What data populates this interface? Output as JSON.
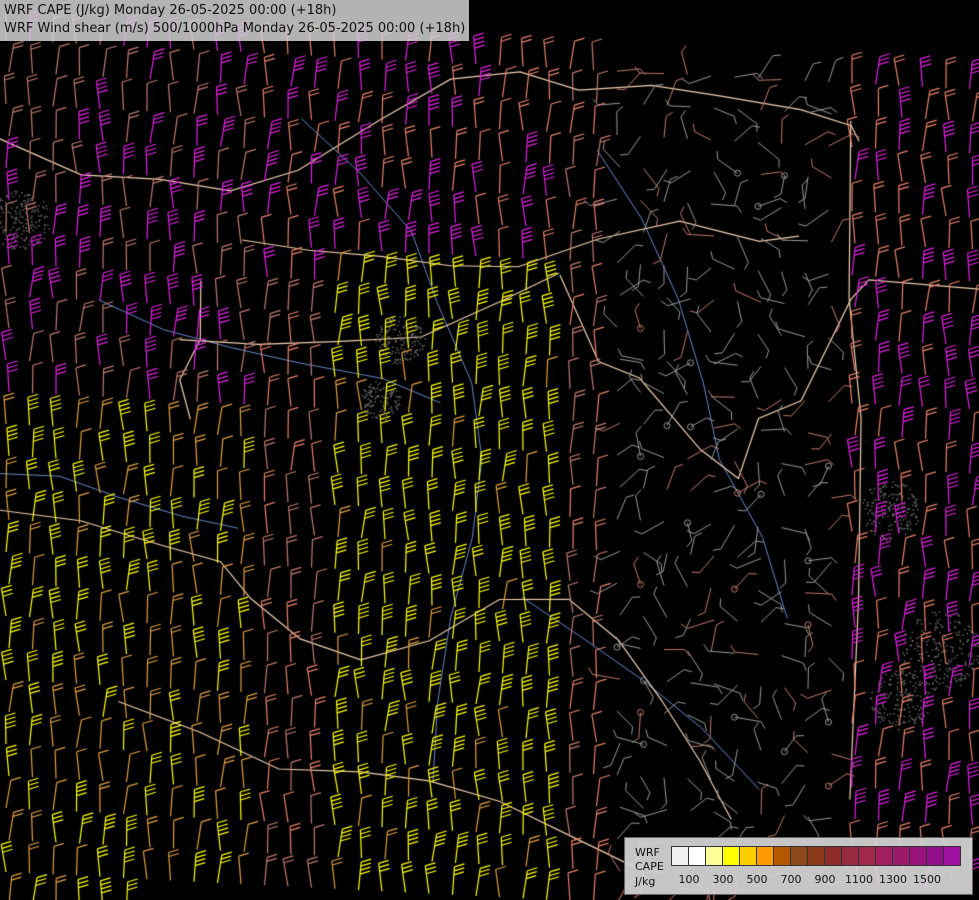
{
  "titles": {
    "line1": "WRF CAPE (J/kg) Monday 26-05-2025 00:00 (+18h)",
    "line2": "WRF Wind shear (m/s) 500/1000hPa Monday 26-05-2025 00:00 (+18h)"
  },
  "legend": {
    "label_wrf": "WRF",
    "label_cape": "CAPE",
    "label_unit": "J/kg",
    "colors": [
      "#f0f0f0",
      "#ffffff",
      "#ffff99",
      "#ffff00",
      "#ffcc00",
      "#ff9900",
      "#b35900",
      "#8c4a1a",
      "#8a3a1a",
      "#8e2a2a",
      "#962a40",
      "#a0284a",
      "#a02060",
      "#9c1a6a",
      "#98147a",
      "#92108a",
      "#a010a0"
    ],
    "tick_labels": [
      "100",
      "300",
      "500",
      "700",
      "900",
      "1100",
      "1300",
      "1500"
    ]
  },
  "barb_colors": {
    "grey": "#9a9a9a",
    "brown": "#c07a70",
    "salmon": "#e8826a",
    "magenta": "#e020e0",
    "yellow": "#ffff00",
    "orange": "#e0a040"
  },
  "map_colors": {
    "background": "#000000",
    "border": "#f0d0b0",
    "river": "#6688cc",
    "terrain_outline": "#888888"
  }
}
